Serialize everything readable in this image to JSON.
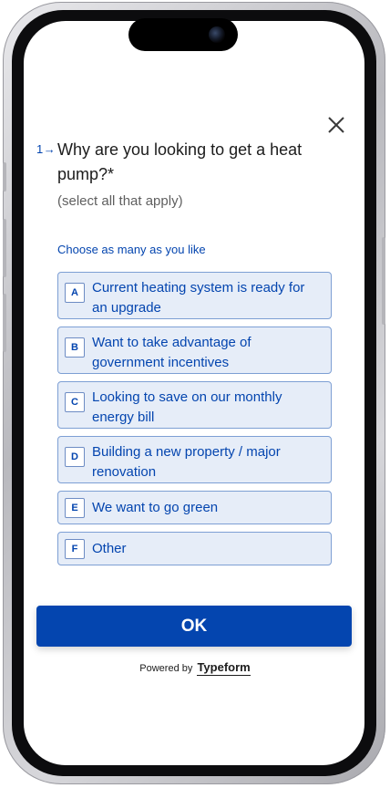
{
  "form": {
    "question_number": "1→",
    "question_title": "Why are you looking to get a heat pump?*",
    "subtitle": "(select all that apply)",
    "hint": "Choose as many as you like",
    "options": [
      {
        "key": "A",
        "label": "Current heating system is ready for an upgrade"
      },
      {
        "key": "B",
        "label": "Want to take advantage of government incentives"
      },
      {
        "key": "C",
        "label": "Looking to save on our monthly energy bill"
      },
      {
        "key": "D",
        "label": "Building a new property / major renovation"
      },
      {
        "key": "E",
        "label": "We want to go green"
      },
      {
        "key": "F",
        "label": "Other"
      }
    ],
    "ok_label": "OK"
  },
  "footer": {
    "powered_by": "Powered by",
    "brand": "Typeform"
  },
  "icons": {
    "close": "close-icon",
    "camera": "camera-icon"
  },
  "colors": {
    "accent": "#0445AF",
    "option_bg": "#E6EDF8",
    "option_border": "#7D9FD4",
    "text": "#1C1C1C"
  }
}
